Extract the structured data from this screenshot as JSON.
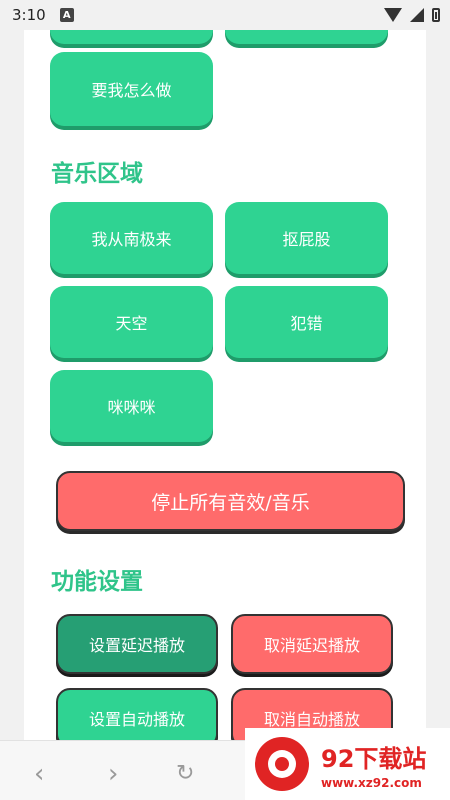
{
  "status_bar": {
    "time": "3:10",
    "notification_letter": "A"
  },
  "buttons_top": {
    "how_do_i": "要我怎么做"
  },
  "music_section": {
    "title": "音乐区域",
    "items": [
      "我从南极来",
      "抠屁股",
      "天空",
      "犯错",
      "咪咪咪"
    ]
  },
  "stop_all_label": "停止所有音效/音乐",
  "settings_section": {
    "title": "功能设置",
    "set_delay": "设置延迟播放",
    "cancel_delay": "取消延迟播放",
    "set_auto": "设置自动播放",
    "cancel_auto": "取消自动播放"
  },
  "watermark": {
    "name": "92下载站",
    "url": "www.xz92.com"
  }
}
